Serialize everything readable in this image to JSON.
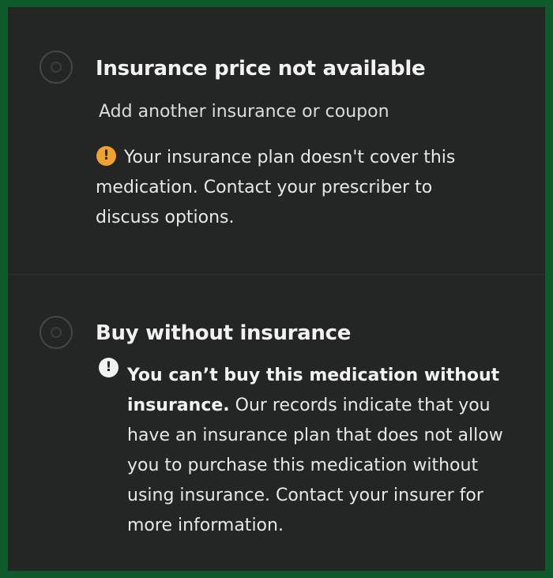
{
  "option_no_insurance_price": {
    "title": "Insurance price not available",
    "link": "Add another insurance or coupon",
    "warning_lines": [
      "Your insurance plan doesn't cover this",
      "medication. Contact your prescriber to",
      "discuss options."
    ]
  },
  "option_without_insurance": {
    "title": "Buy without insurance",
    "bold_line_1": "You can’t buy this medication without",
    "bold_line_2": "insurance.",
    "line_2_rest": " Our records indicate that you",
    "lines": [
      "have an insurance plan that does not allow",
      "you to purchase this medication without",
      "using insurance. Contact your insurer for",
      "more information."
    ]
  },
  "icons": {
    "warning_orange": "exclamation-circle-icon",
    "warning_white": "exclamation-circle-icon"
  },
  "colors": {
    "frame_border": "#0f5a2b",
    "panel_background": "#232625",
    "warning_orange": "#f0a12e"
  }
}
